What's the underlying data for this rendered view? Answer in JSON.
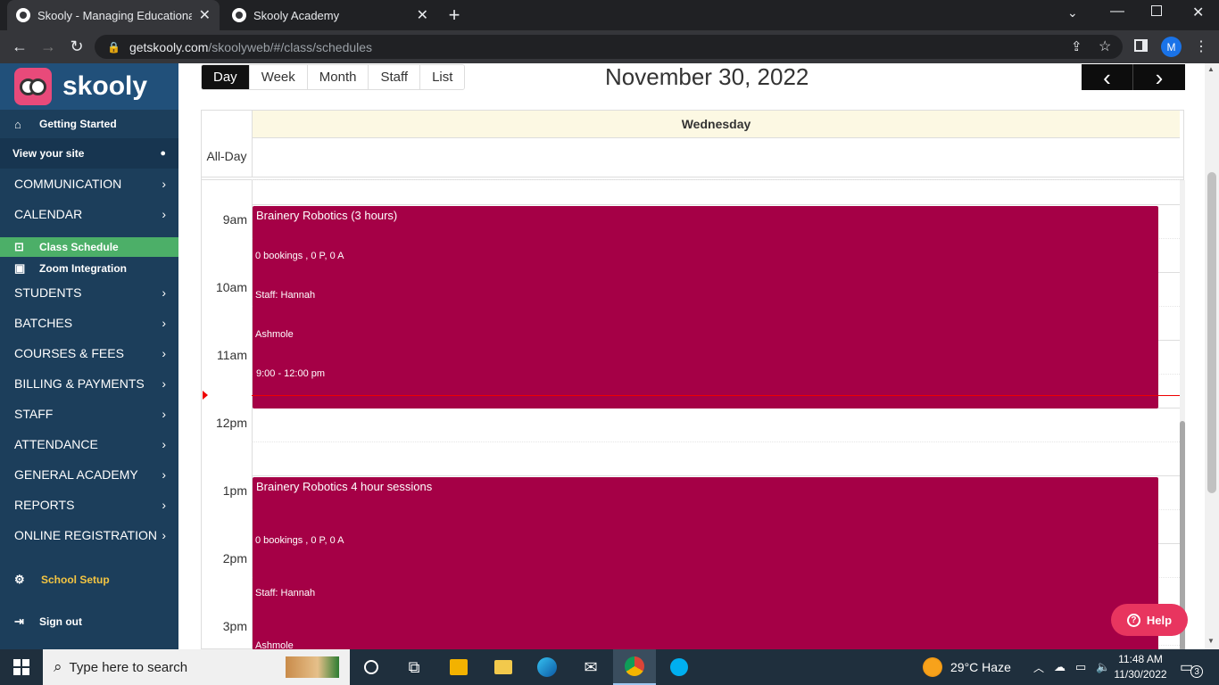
{
  "browser": {
    "tabs": [
      {
        "title": "Skooly - Managing Educational Ins",
        "active": true
      },
      {
        "title": "Skooly Academy",
        "active": false
      }
    ],
    "new_tab": "+",
    "url_host": "getskooly.com",
    "url_path": "/skoolyweb/#/class/schedules",
    "profile_initial": "M"
  },
  "sidebar": {
    "logo": "skooly",
    "getting_started": "Getting Started",
    "view_site": "View your site",
    "categories": {
      "communication": "COMMUNICATION",
      "calendar": "CALENDAR",
      "students": "STUDENTS",
      "batches": "BATCHES",
      "courses": "COURSES & FEES",
      "billing": "BILLING & PAYMENTS",
      "staff": "STAFF",
      "attendance": "ATTENDANCE",
      "general": "GENERAL ACADEMY",
      "reports": "REPORTS",
      "online": "ONLINE REGISTRATION"
    },
    "class_schedule": "Class Schedule",
    "zoom_integration": "Zoom Integration",
    "school_setup": "School Setup",
    "sign_out": "Sign out",
    "colors": {
      "bg": "#1c3e5b",
      "active": "#4caf68",
      "accent": "#f4c542"
    }
  },
  "calendar": {
    "views": [
      "Day",
      "Week",
      "Month",
      "Staff",
      "List"
    ],
    "selected_view": "Day",
    "title": "November 30, 2022",
    "prev": "‹",
    "next": "›",
    "day_header": "Wednesday",
    "all_day_label": "All-Day",
    "hours": [
      "9am",
      "10am",
      "11am",
      "12pm",
      "1pm",
      "2pm",
      "3pm"
    ],
    "events": [
      {
        "title": "Brainery Robotics (3 hours)",
        "bookings": "0 bookings , 0 P, 0 A",
        "staff": "Staff: Hannah",
        "staff_last": "Ashmole",
        "time": "9:00 - 12:00 pm"
      },
      {
        "title": "Brainery Robotics 4 hour sessions",
        "bookings": "0 bookings , 0 P, 0 A",
        "staff": "Staff: Hannah",
        "staff_last": "Ashmole"
      }
    ],
    "event_color": "#a50046",
    "help": "Help"
  },
  "taskbar": {
    "search_placeholder": "Type here to search",
    "weather": "29°C  Haze",
    "time": "11:48 AM",
    "date": "11/30/2022",
    "notifications": "3"
  }
}
